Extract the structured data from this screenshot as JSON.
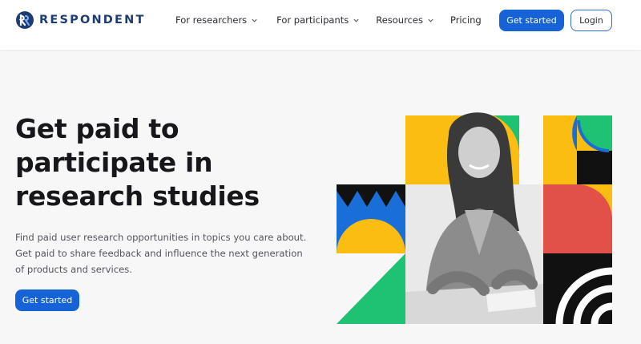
{
  "brand": {
    "name": "RESPONDENT",
    "color": "#1e3c72"
  },
  "nav": {
    "items": [
      {
        "label": "For researchers",
        "icon": "chevron-down-icon"
      },
      {
        "label": "For participants",
        "icon": "chevron-down-icon"
      },
      {
        "label": "Resources",
        "icon": "chevron-down-icon"
      },
      {
        "label": "Pricing"
      }
    ],
    "get_started_label": "Get started",
    "login_label": "Login"
  },
  "hero": {
    "title_lines": [
      "Get paid to",
      "participate in",
      "research studies"
    ],
    "description_lines": [
      "Find paid user research opportunities in topics you care about.",
      "Get paid to share feedback and influence the next generation",
      "of products and services."
    ],
    "cta_label": "Get started"
  },
  "colors": {
    "primary": "#1563d6",
    "yellow": "#fbbd12",
    "green": "#1ec272",
    "blue": "#1a6ed8",
    "red": "#e2504a",
    "black": "#111111"
  }
}
